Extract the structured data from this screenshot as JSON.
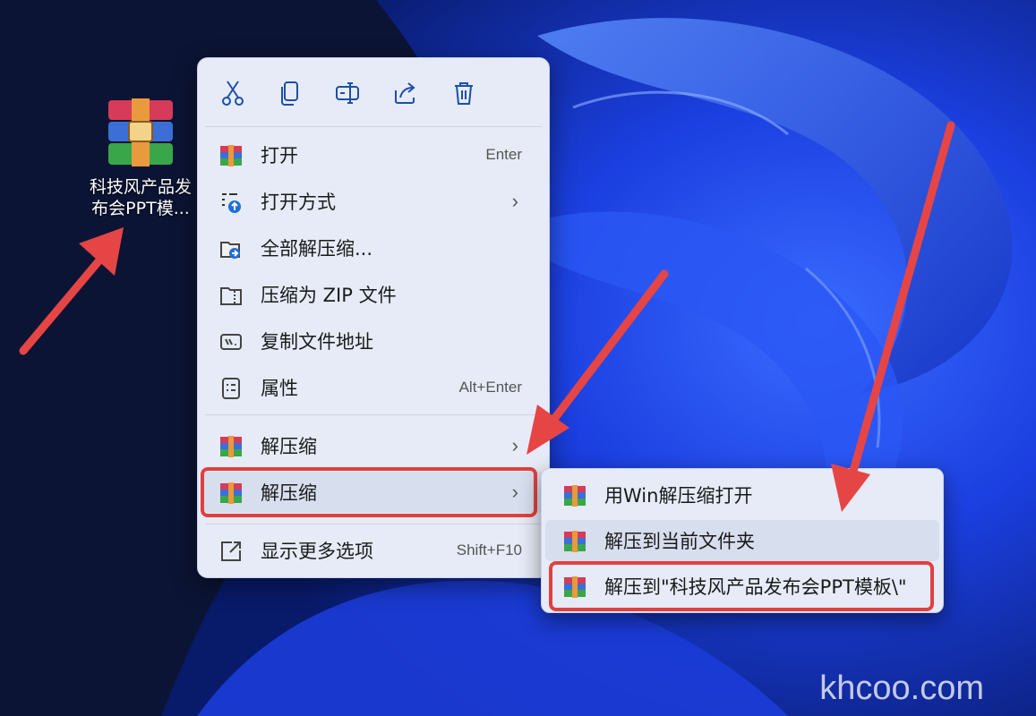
{
  "desktop_icon": {
    "label_line1": "科技风产品发",
    "label_line2": "布会PPT模..."
  },
  "toolbar": {
    "cut_icon": "scissors-icon",
    "copy_icon": "copy-icon",
    "rename_icon": "rename-icon",
    "share_icon": "share-icon",
    "delete_icon": "trash-icon"
  },
  "menu": {
    "items": [
      {
        "label": "打开",
        "accelerator": "Enter",
        "icon": "winrar-icon"
      },
      {
        "label": "打开方式",
        "chevron": "›",
        "icon": "open-with-icon"
      },
      {
        "label": "全部解压缩...",
        "icon": "extract-all-icon"
      },
      {
        "label": "压缩为 ZIP 文件",
        "icon": "zip-icon"
      },
      {
        "label": "复制文件地址",
        "icon": "copy-path-icon"
      },
      {
        "label": "属性",
        "accelerator": "Alt+Enter",
        "icon": "properties-icon"
      },
      {
        "label": "解压缩",
        "chevron": "›",
        "icon": "winrar-icon"
      },
      {
        "label": "解压缩",
        "chevron": "›",
        "icon": "winrar-icon"
      },
      {
        "label": "显示更多选项",
        "accelerator": "Shift+F10",
        "icon": "more-options-icon"
      }
    ]
  },
  "submenu": {
    "items": [
      {
        "label": "用Win解压缩打开"
      },
      {
        "label": "解压到当前文件夹"
      },
      {
        "label": "解压到\"科技风产品发布会PPT模板\\\""
      }
    ]
  },
  "watermark": "khcoo.com",
  "colors": {
    "highlight_red": "#e0413f",
    "menu_bg": "#e6ebf7",
    "wallpaper_blue": "#1a4cff"
  }
}
